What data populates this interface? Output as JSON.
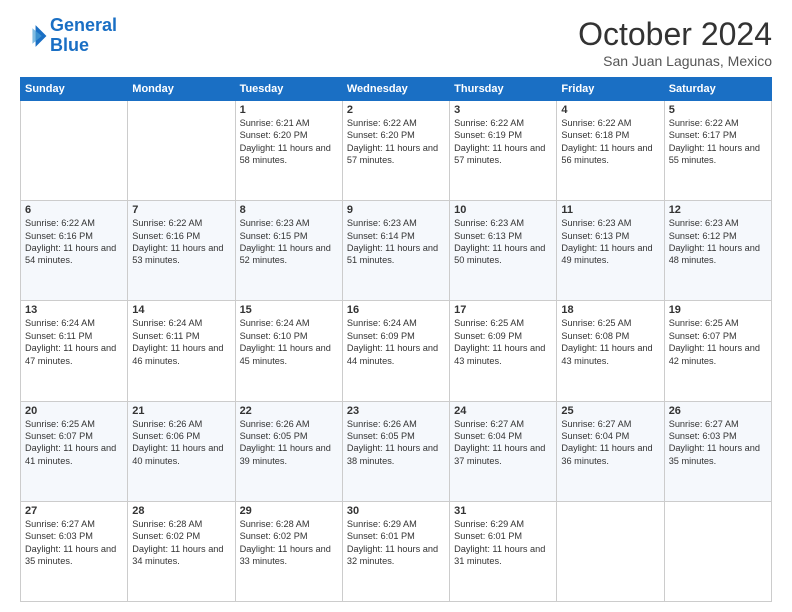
{
  "logo": {
    "line1": "General",
    "line2": "Blue"
  },
  "header": {
    "title": "October 2024",
    "location": "San Juan Lagunas, Mexico"
  },
  "days_of_week": [
    "Sunday",
    "Monday",
    "Tuesday",
    "Wednesday",
    "Thursday",
    "Friday",
    "Saturday"
  ],
  "weeks": [
    [
      {
        "day": "",
        "info": ""
      },
      {
        "day": "",
        "info": ""
      },
      {
        "day": "1",
        "info": "Sunrise: 6:21 AM\nSunset: 6:20 PM\nDaylight: 11 hours and 58 minutes."
      },
      {
        "day": "2",
        "info": "Sunrise: 6:22 AM\nSunset: 6:20 PM\nDaylight: 11 hours and 57 minutes."
      },
      {
        "day": "3",
        "info": "Sunrise: 6:22 AM\nSunset: 6:19 PM\nDaylight: 11 hours and 57 minutes."
      },
      {
        "day": "4",
        "info": "Sunrise: 6:22 AM\nSunset: 6:18 PM\nDaylight: 11 hours and 56 minutes."
      },
      {
        "day": "5",
        "info": "Sunrise: 6:22 AM\nSunset: 6:17 PM\nDaylight: 11 hours and 55 minutes."
      }
    ],
    [
      {
        "day": "6",
        "info": "Sunrise: 6:22 AM\nSunset: 6:16 PM\nDaylight: 11 hours and 54 minutes."
      },
      {
        "day": "7",
        "info": "Sunrise: 6:22 AM\nSunset: 6:16 PM\nDaylight: 11 hours and 53 minutes."
      },
      {
        "day": "8",
        "info": "Sunrise: 6:23 AM\nSunset: 6:15 PM\nDaylight: 11 hours and 52 minutes."
      },
      {
        "day": "9",
        "info": "Sunrise: 6:23 AM\nSunset: 6:14 PM\nDaylight: 11 hours and 51 minutes."
      },
      {
        "day": "10",
        "info": "Sunrise: 6:23 AM\nSunset: 6:13 PM\nDaylight: 11 hours and 50 minutes."
      },
      {
        "day": "11",
        "info": "Sunrise: 6:23 AM\nSunset: 6:13 PM\nDaylight: 11 hours and 49 minutes."
      },
      {
        "day": "12",
        "info": "Sunrise: 6:23 AM\nSunset: 6:12 PM\nDaylight: 11 hours and 48 minutes."
      }
    ],
    [
      {
        "day": "13",
        "info": "Sunrise: 6:24 AM\nSunset: 6:11 PM\nDaylight: 11 hours and 47 minutes."
      },
      {
        "day": "14",
        "info": "Sunrise: 6:24 AM\nSunset: 6:11 PM\nDaylight: 11 hours and 46 minutes."
      },
      {
        "day": "15",
        "info": "Sunrise: 6:24 AM\nSunset: 6:10 PM\nDaylight: 11 hours and 45 minutes."
      },
      {
        "day": "16",
        "info": "Sunrise: 6:24 AM\nSunset: 6:09 PM\nDaylight: 11 hours and 44 minutes."
      },
      {
        "day": "17",
        "info": "Sunrise: 6:25 AM\nSunset: 6:09 PM\nDaylight: 11 hours and 43 minutes."
      },
      {
        "day": "18",
        "info": "Sunrise: 6:25 AM\nSunset: 6:08 PM\nDaylight: 11 hours and 43 minutes."
      },
      {
        "day": "19",
        "info": "Sunrise: 6:25 AM\nSunset: 6:07 PM\nDaylight: 11 hours and 42 minutes."
      }
    ],
    [
      {
        "day": "20",
        "info": "Sunrise: 6:25 AM\nSunset: 6:07 PM\nDaylight: 11 hours and 41 minutes."
      },
      {
        "day": "21",
        "info": "Sunrise: 6:26 AM\nSunset: 6:06 PM\nDaylight: 11 hours and 40 minutes."
      },
      {
        "day": "22",
        "info": "Sunrise: 6:26 AM\nSunset: 6:05 PM\nDaylight: 11 hours and 39 minutes."
      },
      {
        "day": "23",
        "info": "Sunrise: 6:26 AM\nSunset: 6:05 PM\nDaylight: 11 hours and 38 minutes."
      },
      {
        "day": "24",
        "info": "Sunrise: 6:27 AM\nSunset: 6:04 PM\nDaylight: 11 hours and 37 minutes."
      },
      {
        "day": "25",
        "info": "Sunrise: 6:27 AM\nSunset: 6:04 PM\nDaylight: 11 hours and 36 minutes."
      },
      {
        "day": "26",
        "info": "Sunrise: 6:27 AM\nSunset: 6:03 PM\nDaylight: 11 hours and 35 minutes."
      }
    ],
    [
      {
        "day": "27",
        "info": "Sunrise: 6:27 AM\nSunset: 6:03 PM\nDaylight: 11 hours and 35 minutes."
      },
      {
        "day": "28",
        "info": "Sunrise: 6:28 AM\nSunset: 6:02 PM\nDaylight: 11 hours and 34 minutes."
      },
      {
        "day": "29",
        "info": "Sunrise: 6:28 AM\nSunset: 6:02 PM\nDaylight: 11 hours and 33 minutes."
      },
      {
        "day": "30",
        "info": "Sunrise: 6:29 AM\nSunset: 6:01 PM\nDaylight: 11 hours and 32 minutes."
      },
      {
        "day": "31",
        "info": "Sunrise: 6:29 AM\nSunset: 6:01 PM\nDaylight: 11 hours and 31 minutes."
      },
      {
        "day": "",
        "info": ""
      },
      {
        "day": "",
        "info": ""
      }
    ]
  ]
}
